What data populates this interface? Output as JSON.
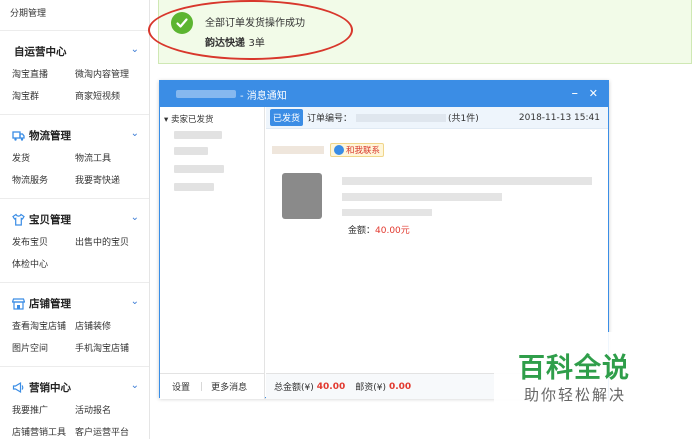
{
  "sidebar": {
    "top_item": "分期管理",
    "sections": [
      {
        "title": "自运营中心",
        "icon": "none",
        "links": [
          "淘宝直播",
          "微淘内容管理",
          "淘宝群",
          "商家短视频"
        ]
      },
      {
        "title": "物流管理",
        "icon": "truck-icon",
        "links": [
          "发货",
          "物流工具",
          "物流服务",
          "我要寄快递"
        ]
      },
      {
        "title": "宝贝管理",
        "icon": "shirt-icon",
        "links": [
          "发布宝贝",
          "出售中的宝贝",
          "体检中心"
        ]
      },
      {
        "title": "店铺管理",
        "icon": "store-icon",
        "links": [
          "查看淘宝店铺",
          "店铺装修",
          "图片空间",
          "手机淘宝店铺"
        ]
      },
      {
        "title": "营销中心",
        "icon": "megaphone-icon",
        "links": [
          "我要推广",
          "活动报名",
          "店铺营销工具",
          "客户运营平台"
        ]
      }
    ]
  },
  "notice": {
    "line1": "全部订单发货操作成功",
    "carrier": "韵达快递",
    "count": "3单"
  },
  "popup": {
    "title": "- 消息通知",
    "minimize": "–",
    "close": "✕",
    "folder": "卖家已发货",
    "badge": "已发货",
    "order_label": "订单编号：",
    "order_count": "(共1件)",
    "order_date": "2018-11-13 15:41",
    "chat_label": "和我联系",
    "amount_label": "金额：",
    "amount_value": "40.00元",
    "footer_settings": "设置",
    "footer_more": "更多消息",
    "total_label": "总金额(¥)",
    "total_value": "40.00",
    "shipping_label": "邮资(¥)",
    "shipping_value": "0.00"
  },
  "watermark": {
    "title": "百科全说",
    "subtitle": "助你轻松解决"
  },
  "colors": {
    "accent_blue": "#3b8de5",
    "success_green": "#5cb531",
    "price_red": "#e2392f",
    "highlight_red": "#d8372c"
  }
}
